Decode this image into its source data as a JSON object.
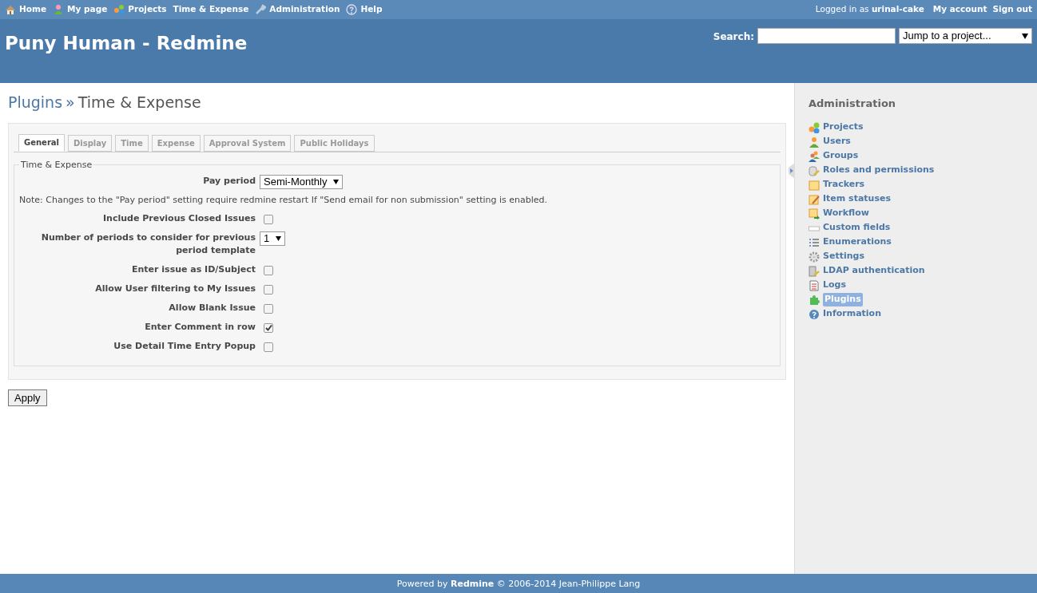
{
  "top_menu": [
    {
      "label": "Home"
    },
    {
      "label": "My page"
    },
    {
      "label": "Projects"
    },
    {
      "label": "Time & Expense"
    },
    {
      "label": "Administration"
    },
    {
      "label": "Help"
    }
  ],
  "account": {
    "logged_in_as": "Logged in as",
    "user": "urinal-cake",
    "links": [
      "My account",
      "Sign out"
    ]
  },
  "header": {
    "title": "Puny Human - Redmine",
    "search_label": "Search:",
    "project_jump": "Jump to a project..."
  },
  "breadcrumb": {
    "parent": "Plugins",
    "separator": "»",
    "current": "Time & Expense"
  },
  "tabs": [
    {
      "label": "General",
      "selected": true
    },
    {
      "label": "Display",
      "selected": false
    },
    {
      "label": "Time",
      "selected": false
    },
    {
      "label": "Expense",
      "selected": false
    },
    {
      "label": "Approval System",
      "selected": false
    },
    {
      "label": "Public Holidays",
      "selected": false
    }
  ],
  "fieldset": {
    "legend": "Time & Expense",
    "settings": [
      {
        "kind": "select",
        "label": "Pay period",
        "value": "Semi-Monthly"
      },
      {
        "kind": "note",
        "text": "Note: Changes to the \"Pay period\" setting require redmine restart If \"Send email for non submission\" setting is enabled."
      },
      {
        "kind": "checkbox",
        "label": "Include Previous Closed Issues",
        "checked": false
      },
      {
        "kind": "select",
        "label": "Number of periods to consider for previous period template",
        "value": "1"
      },
      {
        "kind": "checkbox",
        "label": "Enter issue as ID/Subject",
        "checked": false
      },
      {
        "kind": "checkbox",
        "label": "Allow User filtering to My Issues",
        "checked": false
      },
      {
        "kind": "checkbox",
        "label": "Allow Blank Issue",
        "checked": false
      },
      {
        "kind": "checkbox",
        "label": "Enter Comment in row",
        "checked": true
      },
      {
        "kind": "checkbox",
        "label": "Use Detail Time Entry Popup",
        "checked": false
      }
    ]
  },
  "apply_button": "Apply",
  "sidebar": {
    "title": "Administration",
    "items": [
      {
        "label": "Projects",
        "selected": false
      },
      {
        "label": "Users",
        "selected": false
      },
      {
        "label": "Groups",
        "selected": false
      },
      {
        "label": "Roles and permissions",
        "selected": false
      },
      {
        "label": "Trackers",
        "selected": false
      },
      {
        "label": "Item statuses",
        "selected": false
      },
      {
        "label": "Workflow",
        "selected": false
      },
      {
        "label": "Custom fields",
        "selected": false
      },
      {
        "label": "Enumerations",
        "selected": false
      },
      {
        "label": "Settings",
        "selected": false
      },
      {
        "label": "LDAP authentication",
        "selected": false
      },
      {
        "label": "Logs",
        "selected": false
      },
      {
        "label": "Plugins",
        "selected": true
      },
      {
        "label": "Information",
        "selected": false
      }
    ]
  },
  "footer": "Powered by **Redmine** © 2006-2014 Jean-Philippe Lang"
}
